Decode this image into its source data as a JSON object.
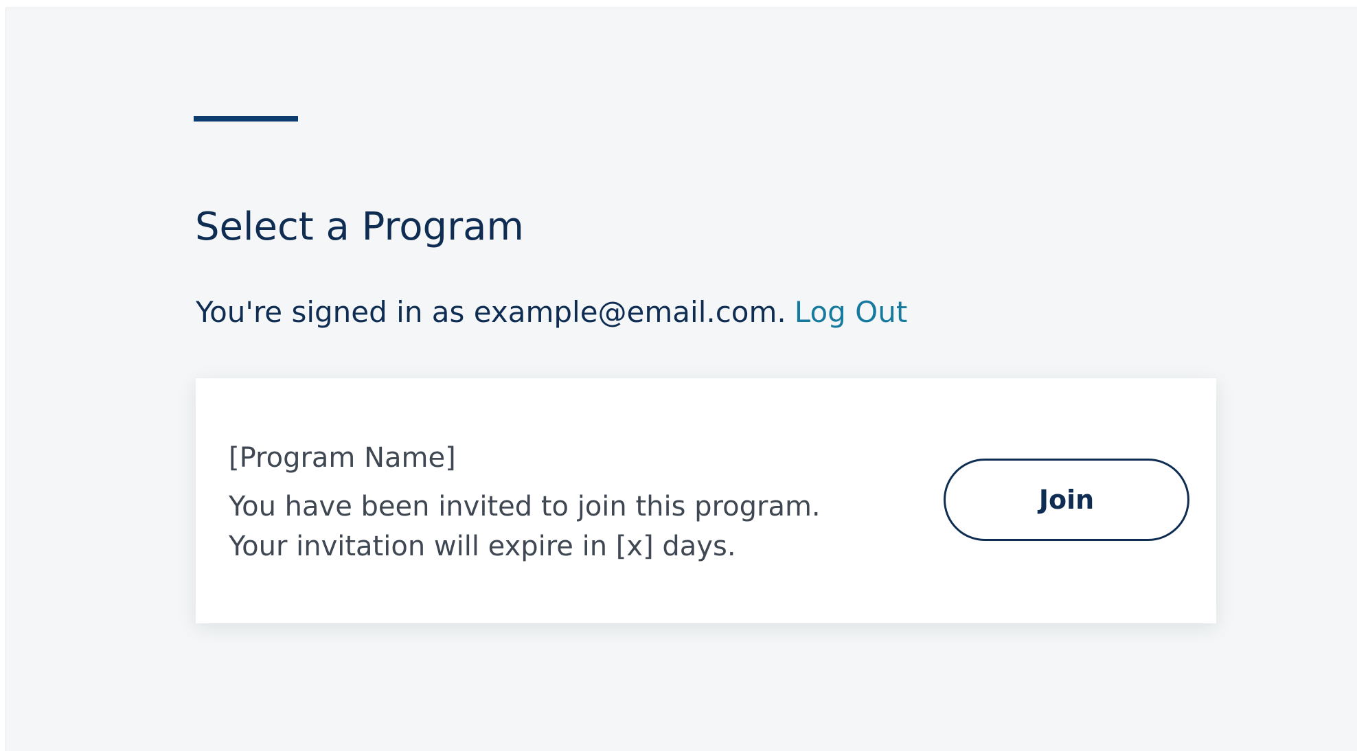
{
  "header": {
    "title": "Select a Program"
  },
  "session": {
    "signed_in_text": "You're signed in as example@email.com.",
    "logout_label": "Log Out"
  },
  "programs": [
    {
      "name": "[Program Name]",
      "invite_line": "You have been invited to join this program.",
      "expire_line": "Your invitation will expire in [x] days.",
      "join_label": "Join"
    }
  ],
  "colors": {
    "accent": "#0d3c6e",
    "heading": "#0f2d52",
    "link": "#167a9e",
    "body_text": "#3f4752",
    "page_background": "#f4f6f7",
    "card_background": "#ffffff"
  }
}
